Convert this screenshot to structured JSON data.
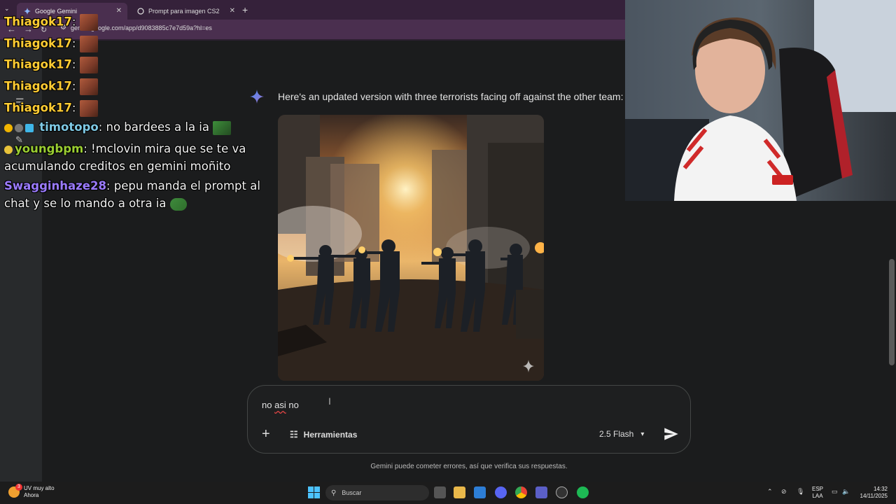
{
  "browser": {
    "tabs": [
      {
        "title": "Google Gemini",
        "active": true
      },
      {
        "title": "Prompt para imagen CS2",
        "active": false
      }
    ],
    "new_tab": "+",
    "url": "gemini.google.com/app/d9083885c7e7d59a?hl=es"
  },
  "gemini": {
    "reply_text": "Here's an updated version with three terrorists facing off against the other team:",
    "input_value": "no asi no",
    "input_words": [
      "no",
      "asi",
      "no"
    ],
    "tools_label": "Herramientas",
    "model_label": "2.5 Flash",
    "disclaimer": "Gemini puede cometer errores, así que verifica sus respuestas."
  },
  "chat": {
    "messages": [
      {
        "user": "Thiagok17",
        "text": ":"
      },
      {
        "user": "Thiagok17",
        "text": ":"
      },
      {
        "user": "Thiagok17",
        "text": ":"
      },
      {
        "user": "Thiagok17",
        "text": ":"
      },
      {
        "user": "Thiagok17",
        "text": ":"
      },
      {
        "user": "timotopo",
        "text": ": no bardees a la ia",
        "color": "#7ec8e3"
      },
      {
        "user": "youngbpm",
        "text": ": !mclovin mira que se te va",
        "color": "#9acd32"
      },
      {
        "line": "acumulando creditos en gemini moñito"
      },
      {
        "user": "Swagginhaze28",
        "text": ": pepu manda el prompt al",
        "color": "#9b7bff"
      },
      {
        "line": "chat y se lo mando a otra ia"
      }
    ]
  },
  "taskbar": {
    "weather_title": "UV muy alto",
    "weather_sub": "Ahora",
    "weather_badge": "3",
    "search_placeholder": "Buscar",
    "lang_top": "ESP",
    "lang_bottom": "LAA",
    "time": "14:32",
    "date": "14/11/2025"
  },
  "colors": {
    "accent_blue": "#4c8df6",
    "user_default": "#ffcc33"
  }
}
